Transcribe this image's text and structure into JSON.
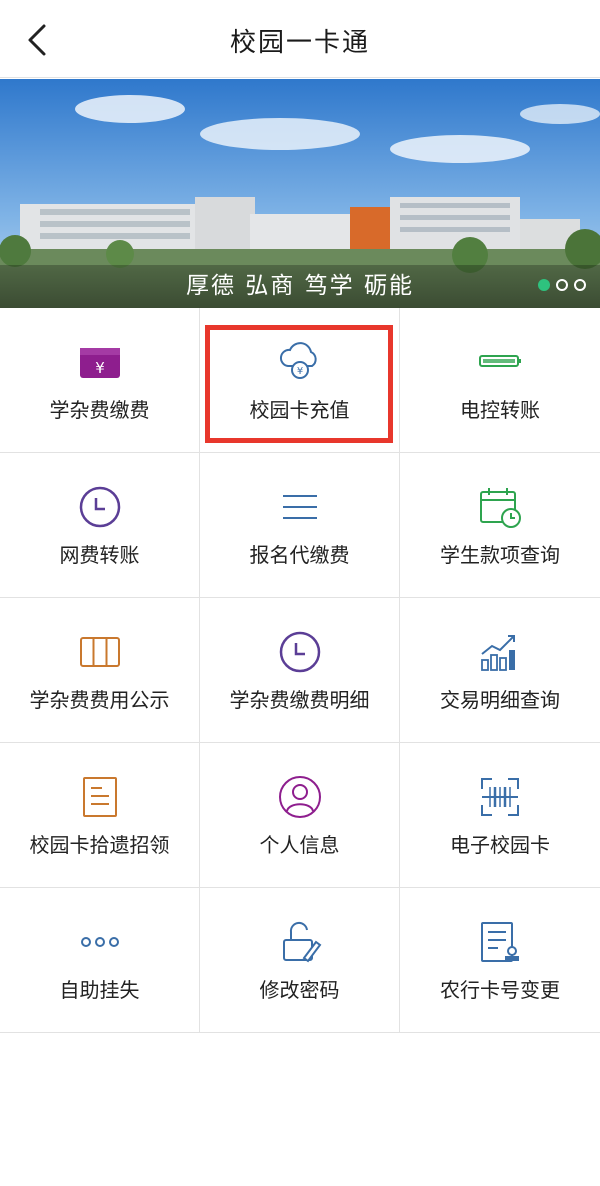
{
  "header": {
    "title": "校园一卡通",
    "back_icon": "chevron-left-icon"
  },
  "banner": {
    "caption": "厚德 弘商 笃学 砺能",
    "slides": 3,
    "active_slide": 1
  },
  "menu": [
    {
      "label": "学杂费缴费",
      "icon": "wallet-yen-icon",
      "color": "#8e1e8e"
    },
    {
      "label": "校园卡充值",
      "icon": "cloud-yen-icon",
      "color": "#3a6ea8"
    },
    {
      "label": "电控转账",
      "icon": "battery-icon",
      "color": "#2ea44f"
    },
    {
      "label": "网费转账",
      "icon": "clock-icon",
      "color": "#5b3e96"
    },
    {
      "label": "报名代缴费",
      "icon": "list-icon",
      "color": "#3a6ea8"
    },
    {
      "label": "学生款项查询",
      "icon": "calendar-clock-icon",
      "color": "#2ea44f"
    },
    {
      "label": "学杂费费用公示",
      "icon": "columns-icon",
      "color": "#c9782e"
    },
    {
      "label": "学杂费缴费明细",
      "icon": "clock-icon",
      "color": "#5b3e96"
    },
    {
      "label": "交易明细查询",
      "icon": "growth-chart-icon",
      "color": "#3a6ea8"
    },
    {
      "label": "校园卡拾遗招领",
      "icon": "document-icon",
      "color": "#c9782e"
    },
    {
      "label": "个人信息",
      "icon": "user-icon",
      "color": "#8e1e8e"
    },
    {
      "label": "电子校园卡",
      "icon": "scan-icon",
      "color": "#3a6ea8"
    },
    {
      "label": "自助挂失",
      "icon": "more-dots-icon",
      "color": "#3a6ea8"
    },
    {
      "label": "修改密码",
      "icon": "unlock-edit-icon",
      "color": "#3a6ea8"
    },
    {
      "label": "农行卡号变更",
      "icon": "form-stamp-icon",
      "color": "#3a6ea8"
    }
  ],
  "highlight_color": "#e8372c"
}
